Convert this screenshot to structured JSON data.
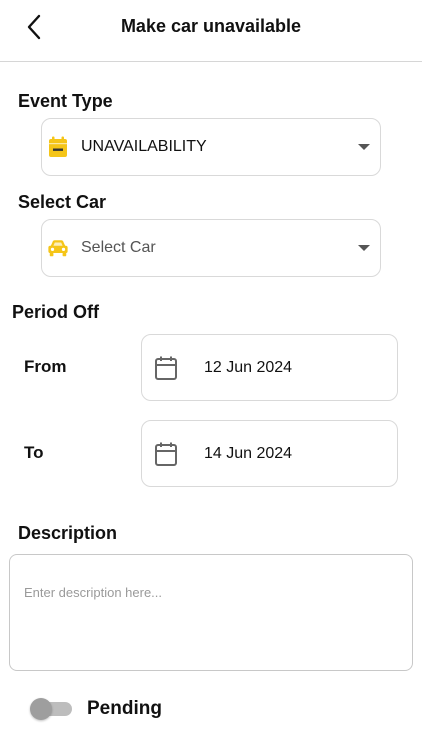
{
  "header": {
    "title": "Make car unavailable",
    "back_icon": "chevron-left-icon"
  },
  "event_type": {
    "label": "Event Type",
    "selected": "UNAVAILABILITY",
    "icon": "calendar-minus-icon",
    "icon_color": "#F5C518"
  },
  "select_car": {
    "label": "Select Car",
    "placeholder": "Select Car",
    "icon": "car-icon",
    "icon_color": "#F5C518"
  },
  "period_off": {
    "label": "Period Off",
    "from_label": "From",
    "from_value": "12 Jun 2024",
    "to_label": "To",
    "to_value": "14 Jun 2024",
    "icon": "calendar-icon"
  },
  "description": {
    "label": "Description",
    "placeholder": "Enter description here..."
  },
  "status_toggle": {
    "label": "Pending",
    "on": false
  },
  "colors": {
    "accent": "#F5C518",
    "border": "#D9D9D9",
    "text": "#111111",
    "placeholder": "#9A9A9A"
  }
}
